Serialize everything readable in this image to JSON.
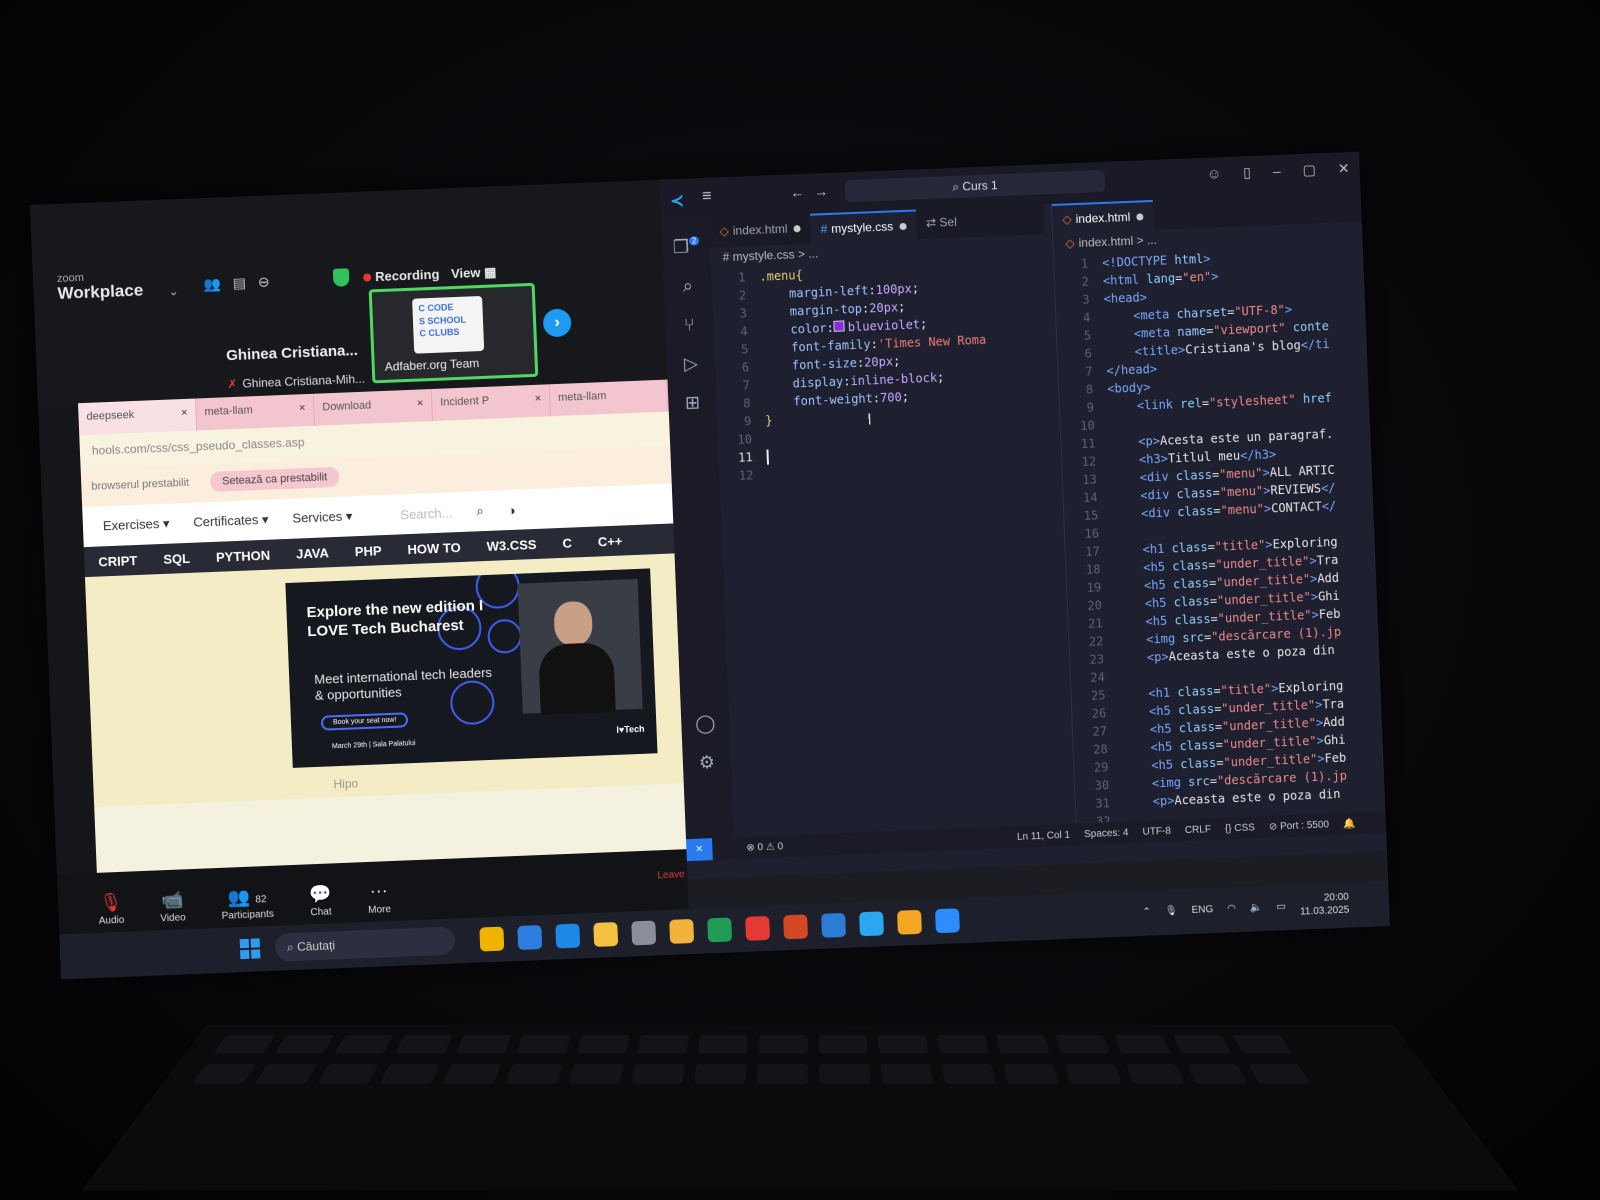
{
  "zoom": {
    "brand_top": "zoom",
    "brand_bottom": "Workplace",
    "recording": "Recording",
    "view": "View",
    "participant_name": "Ghinea Cristiana...",
    "participant_subname": "Ghinea Cristiana-Mih...",
    "active_tile_name": "Adfaber.org Team",
    "tile_logo_lines": [
      "C CODE",
      "S SCHOOL",
      "C CLUBS"
    ],
    "controls": [
      {
        "label": "Audio",
        "icon": "🎙"
      },
      {
        "label": "Video",
        "icon": "📹"
      },
      {
        "label": "Participants",
        "icon": "👥",
        "count": "82"
      },
      {
        "label": "Chat",
        "icon": "💬"
      },
      {
        "label": "More",
        "icon": "⋯"
      }
    ],
    "leave": "Leave"
  },
  "browser": {
    "tabs": [
      {
        "label": "deepseek",
        "close": "×"
      },
      {
        "label": "meta-llam",
        "close": "×"
      },
      {
        "label": "Download",
        "close": "×"
      },
      {
        "label": "Incident P",
        "close": "×"
      },
      {
        "label": "meta-llam",
        "close": ""
      }
    ],
    "url": "hools.com/css/css_pseudo_classes.asp",
    "infobar_text": "browserul prestabilit",
    "infobar_button": "Setează ca prestabilit",
    "nav": [
      "Exercises ▾",
      "Certificates ▾",
      "Services ▾"
    ],
    "search_placeholder": "Search...",
    "subnav": [
      "CRIPT",
      "SQL",
      "PYTHON",
      "JAVA",
      "PHP",
      "HOW TO",
      "W3.CSS",
      "C",
      "C++"
    ],
    "ad": {
      "title": "Explore the new edition I LOVE Tech Bucharest",
      "subtitle": "Meet international tech leaders & opportunities",
      "button": "Book your seat now!",
      "date": "March 29th | Sala Palatului",
      "brand": "I♥Tech"
    },
    "footer_text": "Hipo"
  },
  "vscode": {
    "search": "Curs 1",
    "left_tabs": [
      {
        "label": "index.html",
        "type": "html",
        "modified": true
      },
      {
        "label": "mystyle.css",
        "type": "css",
        "modified": true,
        "active": true
      },
      {
        "label": "Sel",
        "type": "other"
      }
    ],
    "left_crumb": "# mystyle.css > ...",
    "right_tab": "index.html",
    "right_crumb": "index.html > ...",
    "status": {
      "errors": "⊗ 0 ⚠ 0",
      "position": "Ln 11, Col 1",
      "spaces": "Spaces: 4",
      "encoding": "UTF-8",
      "eol": "CRLF",
      "language": "{} CSS",
      "port": "⊘ Port : 5500"
    }
  },
  "css_code": [
    {
      "n": "1",
      "parts": [
        [
          "k-sel",
          ".menu{"
        ]
      ]
    },
    {
      "n": "2",
      "parts": [
        [
          "k-txt",
          "    "
        ],
        [
          "k-prop",
          "margin-left"
        ],
        [
          "k-txt",
          ":"
        ],
        [
          "k-val",
          "100px"
        ],
        [
          "k-txt",
          ";"
        ]
      ]
    },
    {
      "n": "3",
      "parts": [
        [
          "k-txt",
          "    "
        ],
        [
          "k-prop",
          "margin-top"
        ],
        [
          "k-txt",
          ":"
        ],
        [
          "k-val",
          "20px"
        ],
        [
          "k-txt",
          ";"
        ]
      ]
    },
    {
      "n": "4",
      "parts": [
        [
          "k-txt",
          "    "
        ],
        [
          "k-prop",
          "color"
        ],
        [
          "k-txt",
          ":"
        ],
        [
          "swatch",
          ""
        ],
        [
          "k-val",
          "blueviolet"
        ],
        [
          "k-txt",
          ";"
        ]
      ]
    },
    {
      "n": "5",
      "parts": [
        [
          "k-txt",
          "    "
        ],
        [
          "k-prop",
          "font-family"
        ],
        [
          "k-txt",
          ":"
        ],
        [
          "k-str",
          "'Times New Roma"
        ]
      ]
    },
    {
      "n": "6",
      "parts": [
        [
          "k-txt",
          "    "
        ],
        [
          "k-prop",
          "font-size"
        ],
        [
          "k-txt",
          ":"
        ],
        [
          "k-val",
          "20px"
        ],
        [
          "k-txt",
          ";"
        ]
      ]
    },
    {
      "n": "7",
      "parts": [
        [
          "k-txt",
          "    "
        ],
        [
          "k-prop",
          "display"
        ],
        [
          "k-txt",
          ":"
        ],
        [
          "k-val",
          "inline-block"
        ],
        [
          "k-txt",
          ";"
        ]
      ]
    },
    {
      "n": "8",
      "parts": [
        [
          "k-txt",
          "    "
        ],
        [
          "k-prop",
          "font-weight"
        ],
        [
          "k-txt",
          ":"
        ],
        [
          "k-val",
          "700"
        ],
        [
          "k-txt",
          ";"
        ]
      ]
    },
    {
      "n": "9",
      "parts": [
        [
          "k-sel",
          "}"
        ]
      ]
    },
    {
      "n": "10",
      "parts": []
    },
    {
      "n": "11",
      "parts": [
        [
          "cursor",
          ""
        ]
      ],
      "current": true
    },
    {
      "n": "12",
      "parts": []
    }
  ],
  "html_code": [
    {
      "n": "1",
      "parts": [
        [
          "k-tag",
          "<!DOCTYPE "
        ],
        [
          "k-attr",
          "html"
        ],
        [
          "k-tag",
          ">"
        ]
      ]
    },
    {
      "n": "2",
      "parts": [
        [
          "k-tag",
          "<html "
        ],
        [
          "k-attr",
          "lang"
        ],
        [
          "k-txt",
          "="
        ],
        [
          "k-astr",
          "\"en\""
        ],
        [
          "k-tag",
          ">"
        ]
      ]
    },
    {
      "n": "3",
      "parts": [
        [
          "k-tag",
          "<head>"
        ]
      ]
    },
    {
      "n": "4",
      "parts": [
        [
          "k-txt",
          "    "
        ],
        [
          "k-tag",
          "<meta "
        ],
        [
          "k-attr",
          "charset"
        ],
        [
          "k-txt",
          "="
        ],
        [
          "k-astr",
          "\"UTF-8\""
        ],
        [
          "k-tag",
          ">"
        ]
      ]
    },
    {
      "n": "5",
      "parts": [
        [
          "k-txt",
          "    "
        ],
        [
          "k-tag",
          "<meta "
        ],
        [
          "k-attr",
          "name"
        ],
        [
          "k-txt",
          "="
        ],
        [
          "k-astr",
          "\"viewport\""
        ],
        [
          "k-attr",
          " conte"
        ]
      ]
    },
    {
      "n": "6",
      "parts": [
        [
          "k-txt",
          "    "
        ],
        [
          "k-tag",
          "<title>"
        ],
        [
          "k-txt",
          "Cristiana's blog"
        ],
        [
          "k-tag",
          "</ti"
        ]
      ]
    },
    {
      "n": "7",
      "parts": [
        [
          "k-tag",
          "</head>"
        ]
      ]
    },
    {
      "n": "8",
      "parts": [
        [
          "k-tag",
          "<body>"
        ]
      ]
    },
    {
      "n": "9",
      "parts": [
        [
          "k-txt",
          "    "
        ],
        [
          "k-tag",
          "<link "
        ],
        [
          "k-attr",
          "rel"
        ],
        [
          "k-txt",
          "="
        ],
        [
          "k-astr",
          "\"stylesheet\""
        ],
        [
          "k-attr",
          " href"
        ]
      ]
    },
    {
      "n": "10",
      "parts": []
    },
    {
      "n": "11",
      "parts": [
        [
          "k-txt",
          "    "
        ],
        [
          "k-tag",
          "<p>"
        ],
        [
          "k-txt",
          "Acesta este un paragraf."
        ]
      ]
    },
    {
      "n": "12",
      "parts": [
        [
          "k-txt",
          "    "
        ],
        [
          "k-tag",
          "<h3>"
        ],
        [
          "k-txt",
          "Titlul meu"
        ],
        [
          "k-tag",
          "</h3>"
        ]
      ]
    },
    {
      "n": "13",
      "parts": [
        [
          "k-txt",
          "    "
        ],
        [
          "k-tag",
          "<div "
        ],
        [
          "k-attr",
          "class"
        ],
        [
          "k-txt",
          "="
        ],
        [
          "k-astr",
          "\"menu\""
        ],
        [
          "k-tag",
          ">"
        ],
        [
          "k-txt",
          "ALL ARTIC"
        ]
      ]
    },
    {
      "n": "14",
      "parts": [
        [
          "k-txt",
          "    "
        ],
        [
          "k-tag",
          "<div "
        ],
        [
          "k-attr",
          "class"
        ],
        [
          "k-txt",
          "="
        ],
        [
          "k-astr",
          "\"menu\""
        ],
        [
          "k-tag",
          ">"
        ],
        [
          "k-txt",
          "REVIEWS"
        ],
        [
          "k-tag",
          "</"
        ]
      ]
    },
    {
      "n": "15",
      "parts": [
        [
          "k-txt",
          "    "
        ],
        [
          "k-tag",
          "<div "
        ],
        [
          "k-attr",
          "class"
        ],
        [
          "k-txt",
          "="
        ],
        [
          "k-astr",
          "\"menu\""
        ],
        [
          "k-tag",
          ">"
        ],
        [
          "k-txt",
          "CONTACT"
        ],
        [
          "k-tag",
          "</"
        ]
      ]
    },
    {
      "n": "16",
      "parts": []
    },
    {
      "n": "17",
      "parts": [
        [
          "k-txt",
          "    "
        ],
        [
          "k-tag",
          "<h1 "
        ],
        [
          "k-attr",
          "class"
        ],
        [
          "k-txt",
          "="
        ],
        [
          "k-astr",
          "\"title\""
        ],
        [
          "k-tag",
          ">"
        ],
        [
          "k-txt",
          "Exploring"
        ]
      ]
    },
    {
      "n": "18",
      "parts": [
        [
          "k-txt",
          "    "
        ],
        [
          "k-tag",
          "<h5 "
        ],
        [
          "k-attr",
          "class"
        ],
        [
          "k-txt",
          "="
        ],
        [
          "k-astr",
          "\"under_title\""
        ],
        [
          "k-tag",
          ">"
        ],
        [
          "k-txt",
          "Tra"
        ]
      ]
    },
    {
      "n": "19",
      "parts": [
        [
          "k-txt",
          "    "
        ],
        [
          "k-tag",
          "<h5 "
        ],
        [
          "k-attr",
          "class"
        ],
        [
          "k-txt",
          "="
        ],
        [
          "k-astr",
          "\"under_title\""
        ],
        [
          "k-tag",
          ">"
        ],
        [
          "k-txt",
          "Add"
        ]
      ]
    },
    {
      "n": "20",
      "parts": [
        [
          "k-txt",
          "    "
        ],
        [
          "k-tag",
          "<h5 "
        ],
        [
          "k-attr",
          "class"
        ],
        [
          "k-txt",
          "="
        ],
        [
          "k-astr",
          "\"under_title\""
        ],
        [
          "k-tag",
          ">"
        ],
        [
          "k-txt",
          "Ghi"
        ]
      ]
    },
    {
      "n": "21",
      "parts": [
        [
          "k-txt",
          "    "
        ],
        [
          "k-tag",
          "<h5 "
        ],
        [
          "k-attr",
          "class"
        ],
        [
          "k-txt",
          "="
        ],
        [
          "k-astr",
          "\"under_title\""
        ],
        [
          "k-tag",
          ">"
        ],
        [
          "k-txt",
          "Feb"
        ]
      ]
    },
    {
      "n": "22",
      "parts": [
        [
          "k-txt",
          "    "
        ],
        [
          "k-tag",
          "<img "
        ],
        [
          "k-attr",
          "src"
        ],
        [
          "k-txt",
          "="
        ],
        [
          "k-astr",
          "\"descărcare (1).jp"
        ]
      ]
    },
    {
      "n": "23",
      "parts": [
        [
          "k-txt",
          "    "
        ],
        [
          "k-tag",
          "<p>"
        ],
        [
          "k-txt",
          "Aceasta este o poza din"
        ]
      ]
    },
    {
      "n": "24",
      "parts": []
    },
    {
      "n": "25",
      "parts": [
        [
          "k-txt",
          "    "
        ],
        [
          "k-tag",
          "<h1 "
        ],
        [
          "k-attr",
          "class"
        ],
        [
          "k-txt",
          "="
        ],
        [
          "k-astr",
          "\"title\""
        ],
        [
          "k-tag",
          ">"
        ],
        [
          "k-txt",
          "Exploring"
        ]
      ]
    },
    {
      "n": "26",
      "parts": [
        [
          "k-txt",
          "    "
        ],
        [
          "k-tag",
          "<h5 "
        ],
        [
          "k-attr",
          "class"
        ],
        [
          "k-txt",
          "="
        ],
        [
          "k-astr",
          "\"under_title\""
        ],
        [
          "k-tag",
          ">"
        ],
        [
          "k-txt",
          "Tra"
        ]
      ]
    },
    {
      "n": "27",
      "parts": [
        [
          "k-txt",
          "    "
        ],
        [
          "k-tag",
          "<h5 "
        ],
        [
          "k-attr",
          "class"
        ],
        [
          "k-txt",
          "="
        ],
        [
          "k-astr",
          "\"under_title\""
        ],
        [
          "k-tag",
          ">"
        ],
        [
          "k-txt",
          "Add"
        ]
      ]
    },
    {
      "n": "28",
      "parts": [
        [
          "k-txt",
          "    "
        ],
        [
          "k-tag",
          "<h5 "
        ],
        [
          "k-attr",
          "class"
        ],
        [
          "k-txt",
          "="
        ],
        [
          "k-astr",
          "\"under_title\""
        ],
        [
          "k-tag",
          ">"
        ],
        [
          "k-txt",
          "Ghi"
        ]
      ]
    },
    {
      "n": "29",
      "parts": [
        [
          "k-txt",
          "    "
        ],
        [
          "k-tag",
          "<h5 "
        ],
        [
          "k-attr",
          "class"
        ],
        [
          "k-txt",
          "="
        ],
        [
          "k-astr",
          "\"under_title\""
        ],
        [
          "k-tag",
          ">"
        ],
        [
          "k-txt",
          "Feb"
        ]
      ]
    },
    {
      "n": "30",
      "parts": [
        [
          "k-txt",
          "    "
        ],
        [
          "k-tag",
          "<img "
        ],
        [
          "k-attr",
          "src"
        ],
        [
          "k-txt",
          "="
        ],
        [
          "k-astr",
          "\"descărcare (1).jp"
        ]
      ]
    },
    {
      "n": "31",
      "parts": [
        [
          "k-txt",
          "    "
        ],
        [
          "k-tag",
          "<p>"
        ],
        [
          "k-txt",
          "Aceasta este o poza din"
        ]
      ]
    },
    {
      "n": "32",
      "parts": []
    }
  ],
  "taskbar": {
    "search": "Căutați",
    "language": "ENG",
    "time": "20:00",
    "date": "11.03.2025",
    "app_colors": [
      "#f0b400",
      "#2f7de1",
      "#1e88e5",
      "#f5c142",
      "#8a8f9a",
      "#f2b33d",
      "#1f9d55",
      "#e53935",
      "#d24726",
      "#2b7cd3",
      "#2aa7f0",
      "#f5a623",
      "#2d8cff"
    ]
  }
}
